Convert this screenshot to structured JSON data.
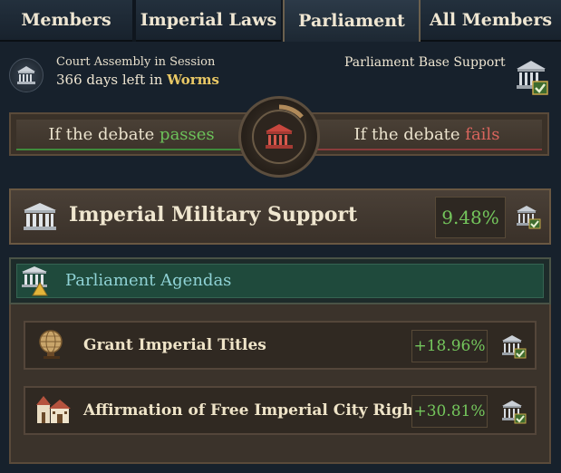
{
  "tabs": [
    {
      "label": "Members"
    },
    {
      "label": "Imperial Laws"
    },
    {
      "label": "Parliament",
      "active": true
    },
    {
      "label": "All Members"
    }
  ],
  "session": {
    "status": "Court Assembly in Session",
    "days_left_prefix": "366 days left in ",
    "location": "Worms"
  },
  "base_support": {
    "label": "Parliament Base Support"
  },
  "debate": {
    "passes_prefix": "If the debate ",
    "passes_word": "passes",
    "fails_prefix": "If the debate ",
    "fails_word": "fails"
  },
  "military_support": {
    "label": "Imperial Military Support",
    "value": "9.48%"
  },
  "agendas": {
    "title": "Parliament Agendas",
    "items": [
      {
        "label": "Grant Imperial Titles",
        "value": "+18.96%",
        "icon": "globe-icon"
      },
      {
        "label": "Affirmation of Free Imperial City Rights",
        "value": "+30.81%",
        "icon": "city-icon"
      }
    ]
  },
  "colors": {
    "positive": "#6cc25a",
    "negative": "#d9655d",
    "gold": "#e9c865",
    "agenda_title": "#8fd2d5"
  }
}
